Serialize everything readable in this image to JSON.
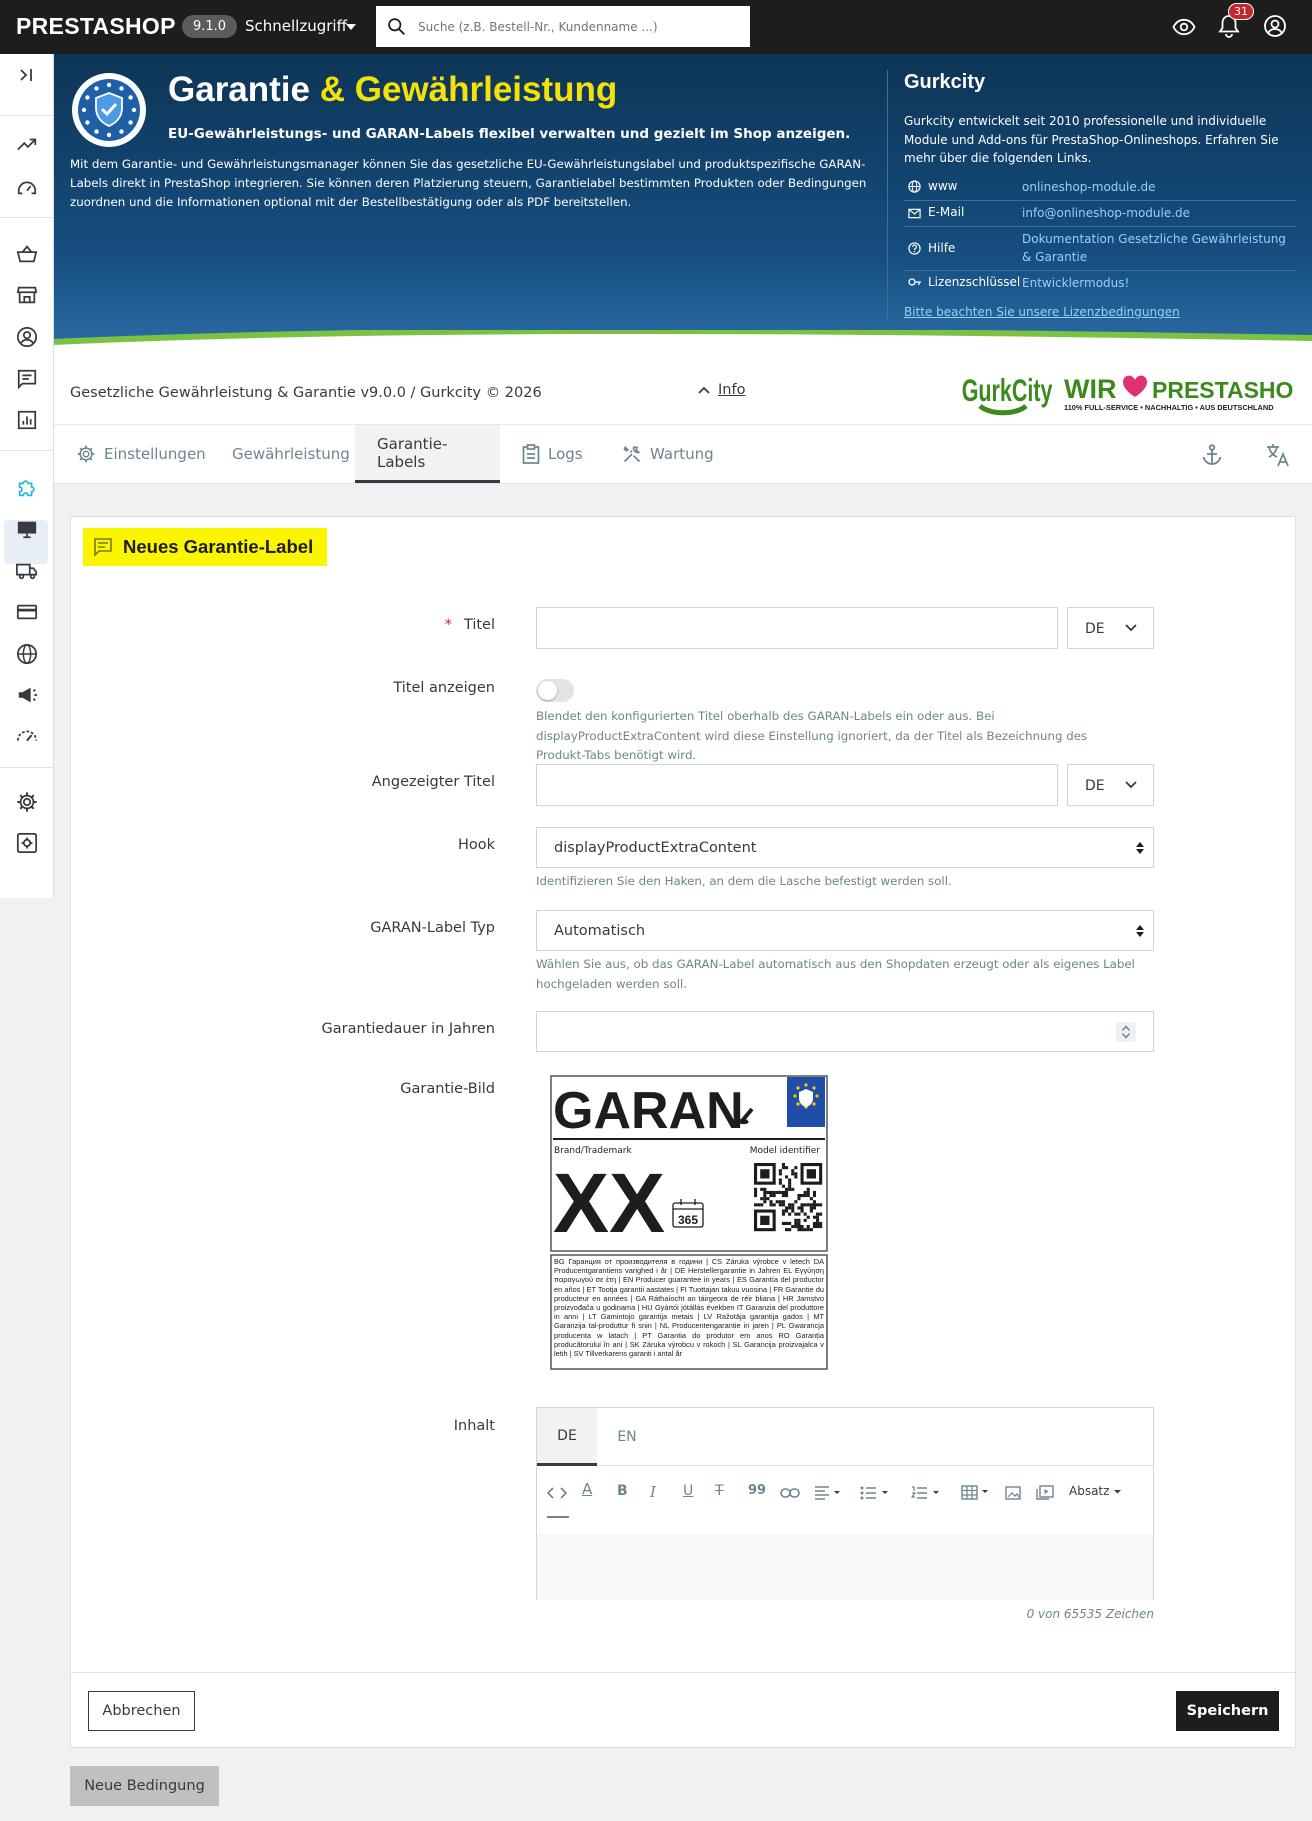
{
  "topbar": {
    "logo": "PRESTASHOP",
    "version": "9.1.0",
    "quick_access": "Schnellzugriff",
    "search_placeholder": "Suche (z.B. Bestell-Nr., Kundenname ...)",
    "notifications_count": "31"
  },
  "header": {
    "title_part1": "Garantie ",
    "title_part2": "& Gewährleistung",
    "subtitle": "EU-Gewährleistungs- und GARAN-Labels flexibel verwalten und gezielt im Shop anzeigen.",
    "description": "Mit dem Garantie- und Gewährleistungsmanager können Sie das gesetzliche EU-Gewährleistungslabel und produktspezifische GARAN-Labels direkt in PrestaShop integrieren. Sie können deren Platzierung steuern, Garantielabel bestimmten Produkten oder Bedingungen zuordnen und die Informationen optional mit der Bestellbestätigung oder als PDF bereitstellen.",
    "brand_title": "Gurkcity",
    "brand_text": "Gurkcity entwickelt seit 2010 professionelle und individuelle Module und Add-ons für PrestaShop-Onlineshops. Erfahren Sie mehr über die folgenden Links.",
    "links": [
      {
        "icon": "globe-icon",
        "label": "www",
        "value": "onlineshop-module.de"
      },
      {
        "icon": "mail-icon",
        "label": "E-Mail",
        "value": "info@onlineshop-module.de"
      },
      {
        "icon": "help-icon",
        "label": "Hilfe",
        "value": "Dokumentation Gesetzliche Gewährleistung & Garantie"
      },
      {
        "icon": "key-icon",
        "label": "Lizenzschlüssel",
        "value": "Entwicklermodus!"
      }
    ],
    "license_link": "Bitte beachten Sie unsere Lizenzbedingungen"
  },
  "strip": {
    "copyright": "Gesetzliche Gewährleistung & Garantie v9.0.0 / Gurkcity © 2026",
    "info": "Info",
    "gurk_logo": "GurkCity",
    "wir_logo_wir": "WIR",
    "wir_logo_presta": "PRESTASHOP",
    "wir_logo_tagline": "110% FULL-SERVICE • NACHHALTIG • AUS DEUTSCHLAND"
  },
  "tabs": [
    "Einstellungen",
    "Gewährleistung",
    "Garantie-Labels",
    "Logs",
    "Wartung"
  ],
  "active_tab": "Garantie-Labels",
  "form": {
    "panel_title": "Neues Garantie-Label",
    "title_label": "Titel",
    "title_lang": "DE",
    "show_title_label": "Titel anzeigen",
    "show_title_help": "Blendet den konfigurierten Titel oberhalb des GARAN-Labels ein oder aus. Bei displayProductExtraContent wird diese Einstellung ignoriert, da der Titel als Bezeichnung des Produkt-Tabs benötigt wird.",
    "show_title_value": false,
    "display_title_label": "Angezeigter Titel",
    "display_title_lang": "DE",
    "hook_label": "Hook",
    "hook_value": "displayProductExtraContent",
    "hook_help": "Identifizieren Sie den Haken, an dem die Lasche befestigt werden soll.",
    "type_label": "GARAN-Label Typ",
    "type_value": "Automatisch",
    "type_help": "Wählen Sie aus, ob das GARAN-Label automatisch aus den Shopdaten erzeugt oder als eigenes Label hochgeladen werden soll.",
    "duration_label": "Garantiedauer in Jahren",
    "image_label": "Garantie-Bild",
    "content_label": "Inhalt",
    "content_langs": [
      "DE",
      "EN"
    ],
    "toolbar_paragraph": "Absatz",
    "counter": "0 von 65535 Zeichen"
  },
  "garan_image": {
    "brand": "GARAN",
    "brand_trademark": "Brand/Trademark",
    "model_identifier": "Model identifier",
    "xx": "XX",
    "days": "365",
    "legal_text": "BG Гаранция от производителя в години | CS Záruka výrobce v letech DA Producentgarantiens varighed i år | DE Herstellergarantie in Jahren EL Εγγύηση παραγωγού σε έτη | EN Producer guarantee in years | ES Garantía del productor en años | ET Tootja garantii aastates | FI Tuottajan takuu vuosina | FR Garantie du producteur en années | GA Ráthaíocht an táirgeora de réir bliana | HR Jamstvo proizvođača u godinama | HU Gyártói jótállás években IT Garanzia del produttore in anni | LT Gamintojo garantija metais | LV Ražotāja garantija gados | MT Garanzija tal-produttur fi snin | NL Producentengarantie in jaren | PL Gwarancja producenta w latach | PT Garantia do produtor em anos RO Garanția producătorului în ani | SK Záruka výrobcu v rokoch | SL Garancija proizvajalca v letih | SV Tillverkarens garanti i antal år"
  },
  "footer": {
    "cancel": "Abbrechen",
    "save": "Speichern",
    "new_condition": "Neue Bedingung"
  },
  "colors": {
    "accent_yellow": "#fcf500",
    "header_blue": "#0d3556",
    "link_blue": "#8fd4f5",
    "wave_green": "#7cc242",
    "badge_red": "#c1272d"
  }
}
